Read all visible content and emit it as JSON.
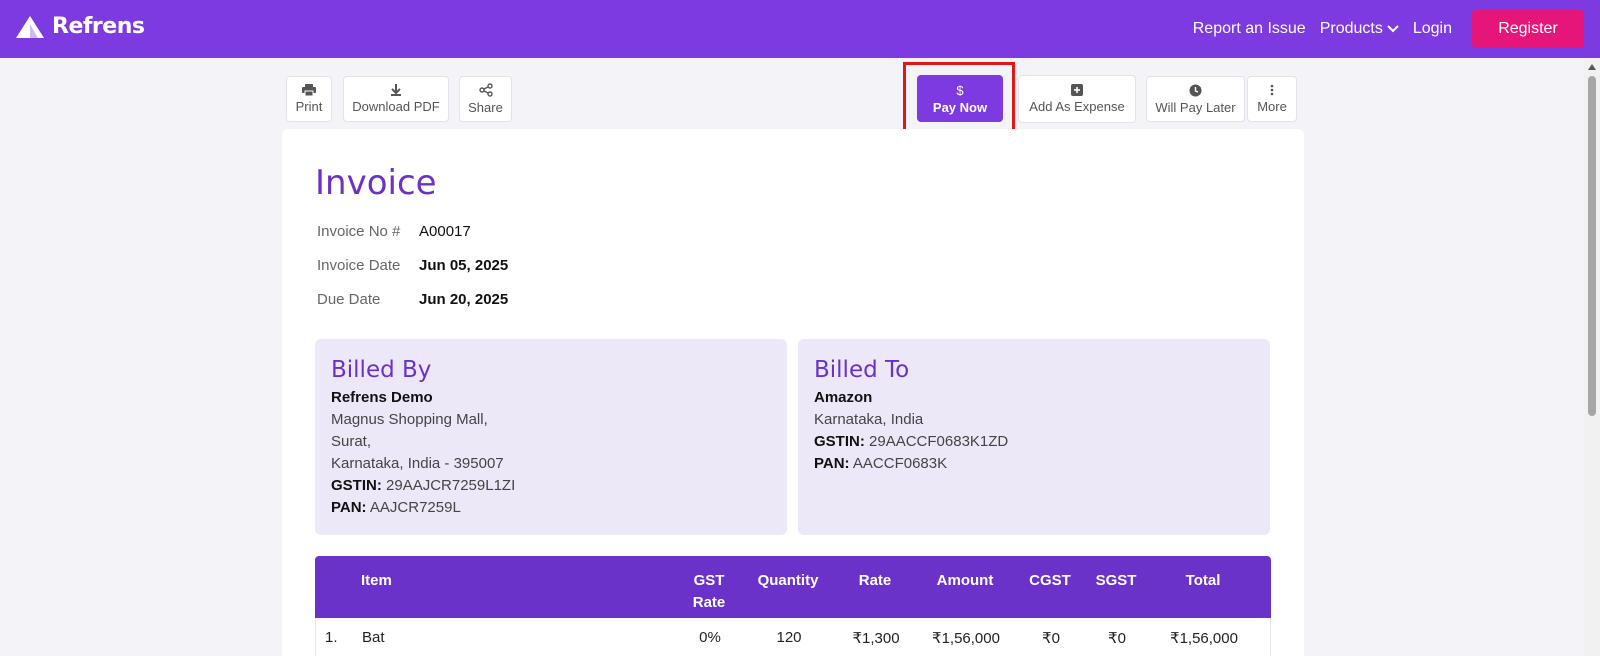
{
  "brand": {
    "name": "Refrens"
  },
  "nav": {
    "report_issue": "Report an Issue",
    "products": "Products",
    "login": "Login",
    "register": "Register"
  },
  "toolbar": {
    "print": "Print",
    "download_pdf": "Download PDF",
    "share": "Share",
    "pay_now_symbol": "$",
    "pay_now": "Pay Now",
    "add_as_expense": "Add As Expense",
    "will_pay_later": "Will Pay Later",
    "more": "More"
  },
  "invoice": {
    "title": "Invoice",
    "number_label": "Invoice No #",
    "number": "A00017",
    "date_label": "Invoice Date",
    "date": "Jun 05, 2025",
    "due_label": "Due Date",
    "due": "Jun 20, 2025"
  },
  "billed_by": {
    "heading": "Billed By",
    "name": "Refrens Demo",
    "address1": "Magnus Shopping Mall,",
    "address2": "Surat,",
    "address3": "Karnataka, India - 395007",
    "gstin_label": "GSTIN:",
    "gstin": "29AAJCR7259L1ZI",
    "pan_label": "PAN:",
    "pan": "AAJCR7259L"
  },
  "billed_to": {
    "heading": "Billed To",
    "name": "Amazon",
    "address1": "Karnataka, India",
    "gstin_label": "GSTIN:",
    "gstin": "29AACCF0683K1ZD",
    "pan_label": "PAN:",
    "pan": "AACCF0683K"
  },
  "table": {
    "headers": {
      "item": "Item",
      "gst_rate_1": "GST",
      "gst_rate_2": "Rate",
      "quantity": "Quantity",
      "rate": "Rate",
      "amount": "Amount",
      "cgst": "CGST",
      "sgst": "SGST",
      "total": "Total"
    },
    "rows": [
      {
        "index": "1.",
        "item": "Bat",
        "gst_rate": "0%",
        "quantity": "120",
        "rate": "₹1,300",
        "amount": "₹1,56,000",
        "cgst": "₹0",
        "sgst": "₹0",
        "total": "₹1,56,000"
      }
    ]
  },
  "colors": {
    "brand": "#7c3ae0",
    "register": "#e5157a",
    "highlight": "#e21616",
    "accent": "#6a32c9"
  }
}
